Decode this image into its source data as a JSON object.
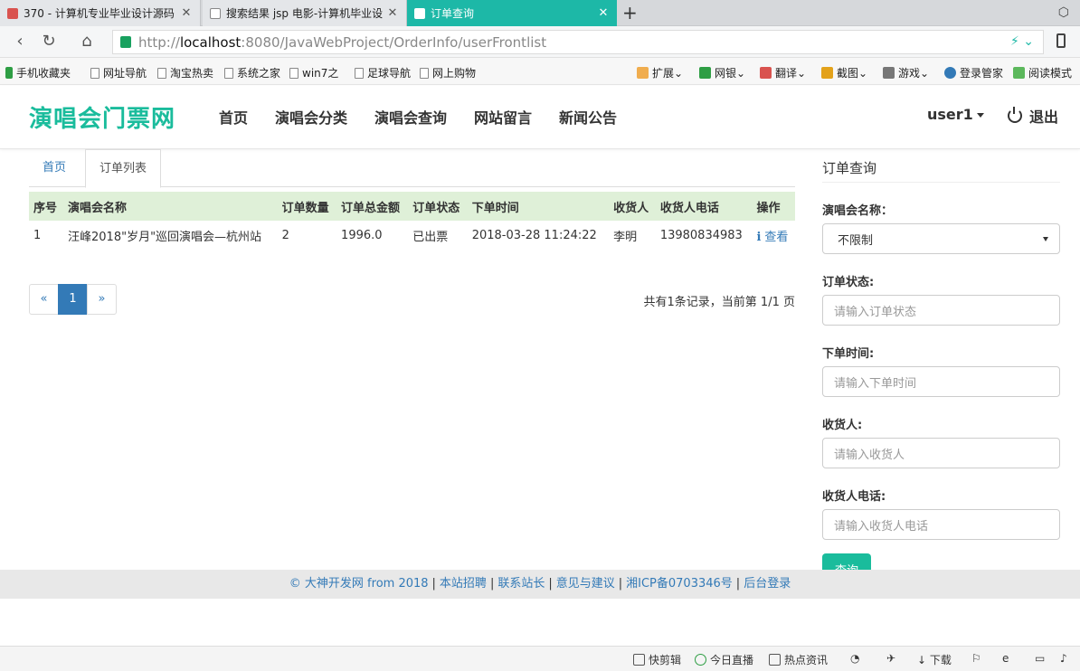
{
  "browser": {
    "tabs": [
      {
        "title": "370 - 计算机专业毕业设计源码",
        "favicon_color": "#d9534f"
      },
      {
        "title": "搜索结果 jsp 电影-计算机毕业设",
        "favicon_color": "#999999"
      },
      {
        "title": "订单查询",
        "favicon_color": "#ffffff",
        "active": true
      }
    ],
    "url_scheme": "http://",
    "url_host": "localhost",
    "url_rest": ":8080/JavaWebProject/OrderInfo/userFrontlist",
    "bookmarks_left": [
      "手机收藏夹",
      "网址导航",
      "淘宝热卖",
      "系统之家",
      "win7之",
      "足球导航",
      "网上购物"
    ],
    "bookmarks_right": [
      "扩展",
      "网银",
      "翻译",
      "截图",
      "游戏",
      "登录管家",
      "阅读模式"
    ]
  },
  "site": {
    "logo": "演唱会门票网",
    "nav": [
      "首页",
      "演唱会分类",
      "演唱会查询",
      "网站留言",
      "新闻公告"
    ],
    "user": "user1",
    "logout": "退出"
  },
  "content_tabs": {
    "home": "首页",
    "active": "订单列表"
  },
  "table": {
    "headers": [
      "序号",
      "演唱会名称",
      "订单数量",
      "订单总金额",
      "订单状态",
      "下单时间",
      "收货人",
      "收货人电话",
      "操作"
    ],
    "rows": [
      {
        "no": "1",
        "concert": "汪峰2018\"岁月\"巡回演唱会—杭州站",
        "qty": "2",
        "amount": "1996.0",
        "status": "已出票",
        "time": "2018-03-28 11:24:22",
        "receiver": "李明",
        "phone": "13980834983",
        "action": "查看"
      }
    ]
  },
  "pager": {
    "prev": "«",
    "current": "1",
    "next": "»",
    "info": "共有1条记录，当前第 1/1 页"
  },
  "sidebar": {
    "title": "订单查询",
    "concert_label": "演唱会名称：",
    "concert_value": "不限制",
    "status_label": "订单状态:",
    "status_placeholder": "请输入订单状态",
    "time_label": "下单时间:",
    "time_placeholder": "请输入下单时间",
    "receiver_label": "收货人:",
    "receiver_placeholder": "请输入收货人",
    "phone_label": "收货人电话:",
    "phone_placeholder": "请输入收货人电话",
    "query_button": "查询"
  },
  "footer": [
    "© 大神开发网 from 2018",
    "本站招聘",
    "联系站长",
    "意见与建议",
    "湘ICP备0703346号",
    "后台登录"
  ],
  "statusbar": [
    "快剪辑",
    "今日直播",
    "热点资讯",
    "下载"
  ],
  "colors": {
    "accent": "#1abc9c",
    "link": "#337ab7",
    "table_header": "#dff0d8"
  }
}
